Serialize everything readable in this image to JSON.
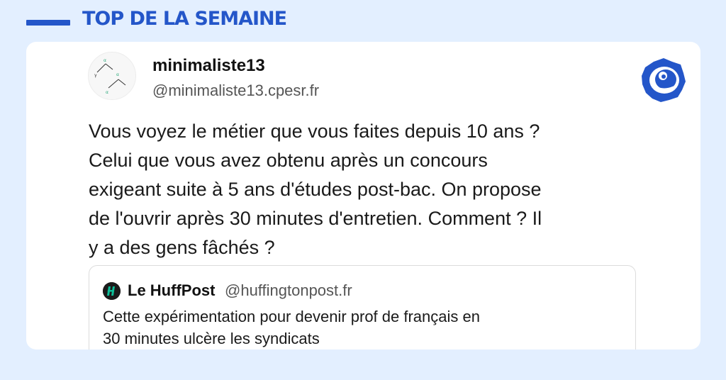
{
  "header": {
    "title": "TOP DE LA SEMAINE",
    "accent_color": "#2456c9",
    "background_color": "#e3efff"
  },
  "post": {
    "author_name": "minimaliste13",
    "author_handle": "@minimaliste13.cpesr.fr",
    "avatar_icon": "tree-diagram-avatar",
    "avatar_glyphs": [
      "α",
      "γ",
      "α",
      "α"
    ],
    "platform_icon": "bluesky-client-logo",
    "text": "Vous voyez le métier que vous faites depuis 10 ans ?\nCelui que vous avez obtenu après un concours\nexigeant suite à 5 ans d'études post-bac. On propose\nde l'ouvrir après 30 minutes d'entretien. Comment ? Il\ny a des gens fâchés ?"
  },
  "quote": {
    "icon": "huffpost-icon",
    "author_name": "Le HuffPost",
    "author_handle": "@huffingtonpost.fr",
    "text": "Cette expérimentation pour devenir prof de français en\n30 minutes ulcère les syndicats"
  }
}
